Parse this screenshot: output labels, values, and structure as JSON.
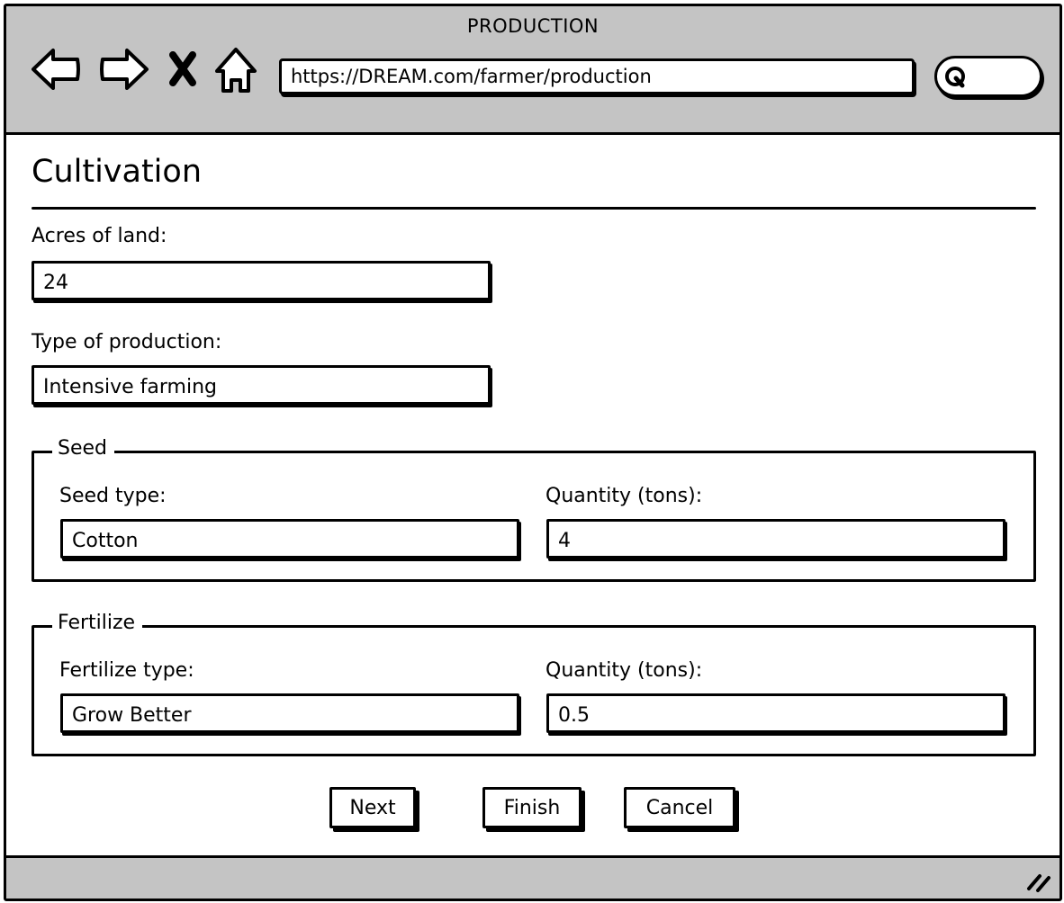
{
  "browser": {
    "window_title": "PRODUCTION",
    "url": "https://DREAM.com/farmer/production",
    "icons": {
      "back": "back-arrow-icon",
      "forward": "forward-arrow-icon",
      "stop": "close-icon",
      "home": "home-icon",
      "search": "search-icon",
      "resize": "resize-grip-icon"
    }
  },
  "form": {
    "title": "Cultivation",
    "acres": {
      "label": "Acres of land:",
      "value": "24"
    },
    "production_type": {
      "label": "Type of production:",
      "value": "Intensive farming"
    },
    "seed": {
      "legend": "Seed",
      "type_label": "Seed type:",
      "type_value": "Cotton",
      "quantity_label": "Quantity (tons):",
      "quantity_value": "4"
    },
    "fertilize": {
      "legend": "Fertilize",
      "type_label": "Fertilize type:",
      "type_value": "Grow Better",
      "quantity_label": "Quantity (tons):",
      "quantity_value": "0.5"
    }
  },
  "actions": {
    "next_label": "Next",
    "finish_label": "Finish",
    "cancel_label": "Cancel"
  }
}
